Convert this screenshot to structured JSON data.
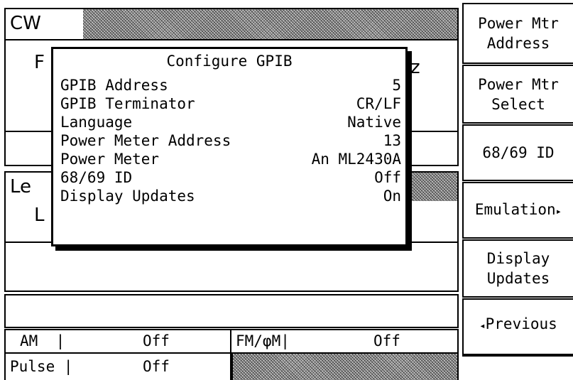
{
  "main": {
    "mode": "CW",
    "freq_prefix": "F",
    "freq_suffix": "z",
    "level_prefix": "Le",
    "level_sub": "L"
  },
  "status": {
    "am_label": "AM  |",
    "am_value": "Off",
    "fm_label": "FM/φM|",
    "fm_value": "Off",
    "pulse_label": "Pulse |",
    "pulse_value": "Off"
  },
  "dialog": {
    "title": "Configure GPIB",
    "rows": [
      {
        "label": "GPIB Address",
        "value": "5"
      },
      {
        "label": "GPIB Terminator",
        "value": "CR/LF"
      },
      {
        "label": "Language",
        "value": "Native"
      },
      {
        "label": "Power Meter Address",
        "value": "13"
      },
      {
        "label": "Power Meter",
        "value": "An ML2430A"
      },
      {
        "label": "68/69 ID",
        "value": "Off"
      },
      {
        "label": "Display Updates",
        "value": "On"
      }
    ]
  },
  "softkeys": [
    {
      "line1": "Power Mtr",
      "line2": "Address"
    },
    {
      "line1": "Power Mtr",
      "line2": "Select"
    },
    {
      "line1": "68/69 ID",
      "line2": ""
    },
    {
      "line1": "Emulation",
      "line2": "",
      "arrow_right": "▸"
    },
    {
      "line1": "Display",
      "line2": "Updates"
    },
    {
      "line1": "Previous",
      "line2": "",
      "arrow_left": "◂"
    }
  ],
  "icons": [
    "submenu-arrow-icon",
    "back-arrow-icon"
  ]
}
